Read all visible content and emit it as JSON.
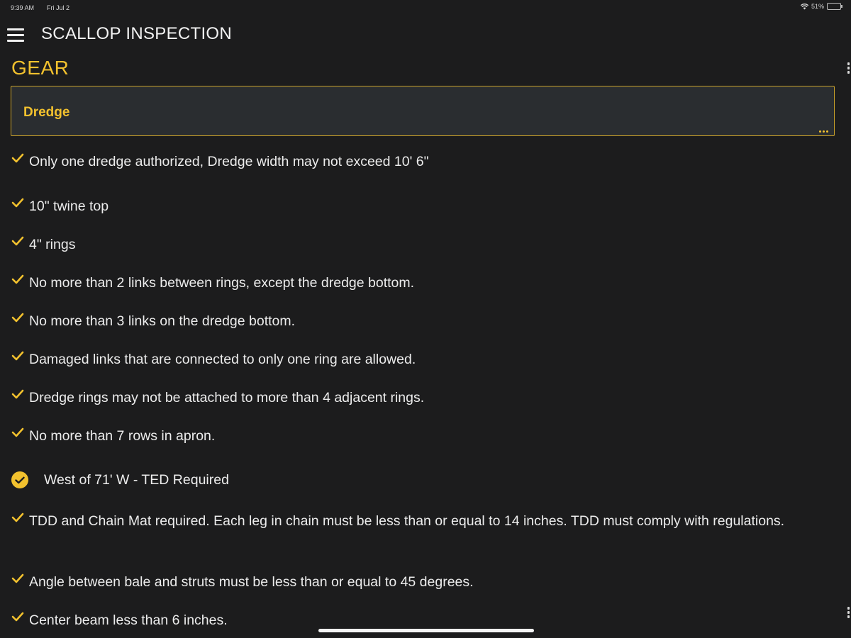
{
  "status_bar": {
    "time": "9:39 AM",
    "date": "Fri Jul 2",
    "battery": "51%",
    "battery_level": 0.51
  },
  "header": {
    "title": "SCALLOP INSPECTION",
    "menu_icon": "hamburger-menu-icon"
  },
  "section": {
    "title": "GEAR"
  },
  "gear_select": {
    "value": "Dredge",
    "more_icon": "ellipsis-icon"
  },
  "checklist": {
    "items": [
      "Only one dredge authorized, Dredge width may not exceed 10' 6\"",
      "10\" twine top",
      "4\" rings",
      "No more than 2 links between rings, except the dredge bottom.",
      "No more than 3 links on the dredge bottom.",
      "Damaged links that are connected to only one ring are allowed.",
      "Dredge rings may not be attached to more than 4 adjacent rings.",
      "No more than 7 rows in apron."
    ]
  },
  "subsection": {
    "title": "West of 71' W - TED Required",
    "items": [
      "TDD and Chain Mat required. Each leg in chain must be less than or equal to 14 inches. TDD must comply with regulations.",
      "Angle between bale and struts must be less than or equal to 45 degrees.",
      "Center beam less than 6 inches."
    ]
  },
  "colors": {
    "background": "#1c1c1d",
    "accent": "#f2c12e",
    "select_background": "#2a2d30",
    "text": "#ececec"
  }
}
